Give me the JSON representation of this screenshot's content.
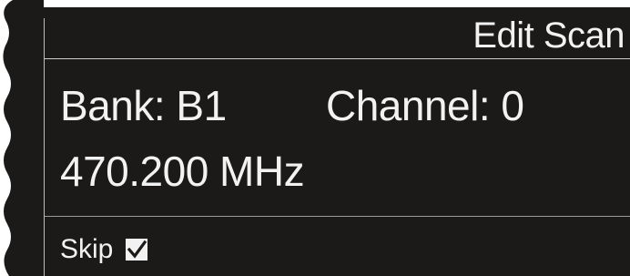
{
  "screen": {
    "title": "Edit Scan",
    "bank_text": "Bank: B1",
    "channel_text": "Channel: 0",
    "frequency_text": "470.200 MHz",
    "skip_label": "Skip",
    "skip_checked": true
  },
  "icons": {
    "skip_checkbox": "checkbox-checked-icon"
  },
  "colors": {
    "screen_background": "#1c1a19",
    "text": "#f2f2f2",
    "divider": "#cfcfcf"
  }
}
